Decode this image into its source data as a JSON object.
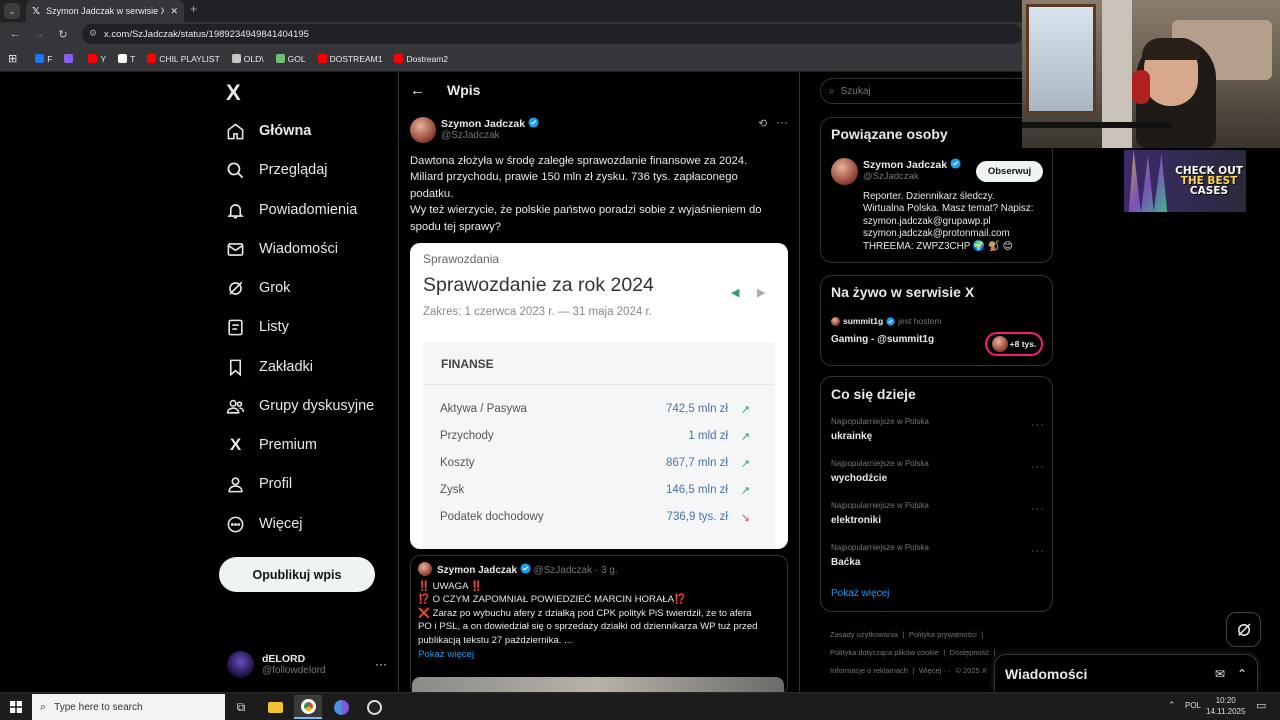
{
  "browser": {
    "tab_title": "Szymon Jadczak w serwisie X: „",
    "url": "x.com/SzJadczak/status/1989234949841404195",
    "bookmarks": [
      {
        "label": "F",
        "color": "#1877f2"
      },
      {
        "label": "",
        "color": "#8b5cf6"
      },
      {
        "label": "Y",
        "color": "#ff0000"
      },
      {
        "label": "T",
        "color": "#ffffff"
      },
      {
        "label": "CHIL PLAYLIST",
        "color": "#ff0000"
      },
      {
        "label": "OLD\\",
        "color": "#c4c7c5"
      },
      {
        "label": "GOL",
        "color": "#6fbf73"
      },
      {
        "label": "DOSTREAM1",
        "color": "#ff0000"
      },
      {
        "label": "Dostream2",
        "color": "#ff0000"
      }
    ]
  },
  "nav": {
    "logo": "X",
    "items": [
      "Główna",
      "Przeglądaj",
      "Powiadomienia",
      "Wiadomości",
      "Grok",
      "Listy",
      "Zakładki",
      "Grupy dyskusyjne",
      "Premium",
      "Profil",
      "Więcej"
    ],
    "post_button": "Opublikuj wpis",
    "account": {
      "name": "dELORD",
      "handle": "@followdelord"
    }
  },
  "post": {
    "header_title": "Wpis",
    "author_name": "Szymon Jadczak",
    "author_handle": "@SzJadczak",
    "text": [
      "Dawtona złożyła w środę zaległe sprawozdanie finansowe za 2024.",
      "Miliard przychodu, prawie 150 mln zł zysku. 736 tys. zapłaconego",
      "podatku.",
      "Wy też wierzycie, że polskie państwo poradzi sobie z wyjaśnieniem do",
      "spodu tej sprawy?"
    ],
    "card": {
      "section": "Sprawozdania",
      "title": "Sprawozdanie za rok 2024",
      "range": "Zakres: 1 czerwca 2023 r. — 31 maja 2024 r.",
      "box_title": "FINANSE",
      "rows": [
        {
          "label": "Aktywa / Pasywa",
          "value": "742,5 mln zł",
          "arrow": "↗",
          "color": "#2e9e6a"
        },
        {
          "label": "Przychody",
          "value": "1 mld zł",
          "arrow": "↗",
          "color": "#2e9e6a"
        },
        {
          "label": "Koszty",
          "value": "867,7 mln zł",
          "arrow": "↗",
          "color": "#2e9e6a"
        },
        {
          "label": "Zysk",
          "value": "146,5 mln zł",
          "arrow": "↗",
          "color": "#2e9e6a"
        },
        {
          "label": "Podatek dochodowy",
          "value": "736,9 tys. zł",
          "arrow": "↘",
          "color": "#e0523a"
        }
      ]
    }
  },
  "reply": {
    "author_name": "Szymon Jadczak",
    "author_handle": "@SzJadczak · 3 g.",
    "lines": [
      "‼️ UWAGA ‼️",
      "⁉️ O CZYM ZAPOMNIAŁ POWIEDZIEĆ MARCIN HORAŁA⁉️",
      "❌ Zaraz po wybuchu afery z działką pod CPK polityk PiS twierdził, że to afera",
      "PO i PSL, a on dowiedział się o sprzedaży działki od dziennikarza WP tuż przed",
      "publikacją tekstu 27 października. ..."
    ],
    "show_more": "Pokaż więcej"
  },
  "right": {
    "search_placeholder": "Szukaj",
    "related": {
      "title": "Powiązane osoby",
      "name": "Szymon Jadczak",
      "handle": "@SzJadczak",
      "follow": "Obserwuj",
      "bio": [
        "Reporter. Dziennikarz śledczy.",
        "Wirtualna Polska. Masz temat? Napisz:",
        "szymon.jadczak@grupawp.pl",
        "szymon.jadczak@protonmail.com",
        "THREEMA: ZWPZ3CHP 🌍 🐒 😊"
      ]
    },
    "live": {
      "title": "Na żywo w serwisie X",
      "host": "summit1g",
      "host_suffix": "jest hostem",
      "stream": "Gaming - @summit1g",
      "listeners": "+8 tys."
    },
    "trends": {
      "title": "Co się dzieje",
      "items": [
        {
          "context": "Najpopularniejsze w Polska",
          "name": "ukrainkę"
        },
        {
          "context": "Najpopularniejsze w Polska",
          "name": "wychodźcie"
        },
        {
          "context": "Najpopularniejsze w Polska",
          "name": "elektroniki"
        },
        {
          "context": "Najpopularniejsze w Polska",
          "name": "Baćka"
        }
      ],
      "show_more": "Pokaż więcej"
    },
    "footer": [
      "Zasady użytkowania",
      "Polityka prywatności",
      "Polityka dotycząca plików cookie",
      "Dostępność",
      "Informacje o reklamach",
      "Więcej ···",
      "© 2025 X"
    ],
    "messages_drawer": "Wiadomości"
  },
  "overlay": {
    "promo_lines": [
      "CHECK OUT",
      "THE BEST",
      "CASES"
    ]
  },
  "taskbar": {
    "search_placeholder": "Type here to search",
    "lang": "POL",
    "time": "10:20",
    "date": "14.11.2025"
  }
}
